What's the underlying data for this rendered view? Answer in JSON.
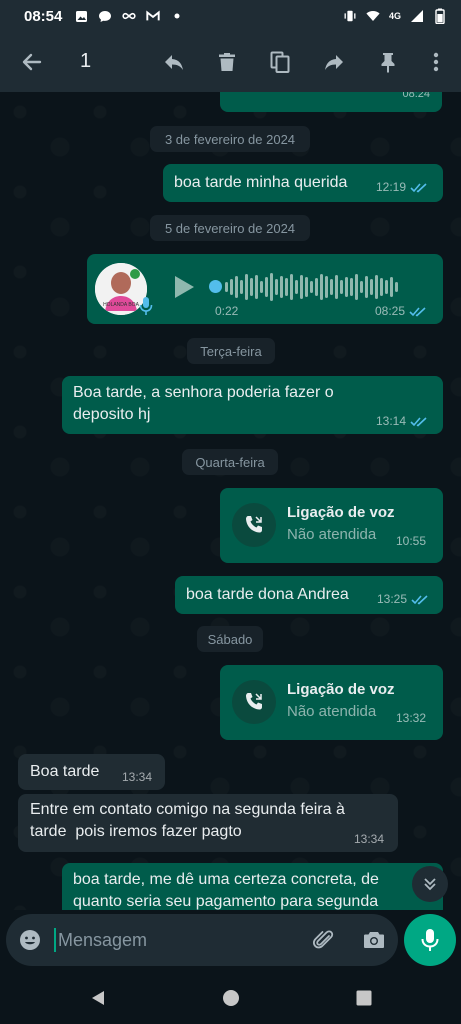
{
  "status_bar": {
    "time": "08:54",
    "network": "4G",
    "left_icons": [
      "image-icon",
      "chat-bubble-icon",
      "infinity-icon",
      "gmail-icon",
      "dot-icon"
    ],
    "right_icons": [
      "vibrate-icon",
      "wifi-icon",
      "signal-icon",
      "battery-icon"
    ]
  },
  "action_bar": {
    "selected_count": "1",
    "actions": [
      "back",
      "reply",
      "delete",
      "copy",
      "forward",
      "pin",
      "more"
    ]
  },
  "messages": {
    "top_partial_time": "08:24",
    "date1": "3 de fevereiro de 2024",
    "m1_text": "boa tarde minha querida",
    "m1_time": "12:19",
    "date2": "5 de fevereiro de 2024",
    "voice": {
      "duration": "0:22",
      "time": "08:25",
      "avatar_caption": "HOLANDA BOA"
    },
    "date3": "Terça-feira",
    "m2_line1": "Boa tarde, a senhora poderia fazer o",
    "m2_line2": "deposito hj",
    "m2_time": "13:14",
    "date4": "Quarta-feira",
    "call1_title": "Ligação de voz",
    "call1_sub": "Não atendida",
    "call1_time": "10:55",
    "m3_text": "boa tarde dona Andrea",
    "m3_time": "13:25",
    "date5": "Sábado",
    "call2_title": "Ligação de voz",
    "call2_sub": "Não atendida",
    "call2_time": "13:32",
    "in1_text": "Boa tarde",
    "in1_time": "13:34",
    "in2_line1": "Entre em contato comigo na segunda feira à",
    "in2_line2": "tarde  pois iremos fazer pagto",
    "in2_time": "13:34",
    "m4_line1": "boa tarde, me dê uma certeza concreta, de",
    "m4_line2": "quanto seria seu pagamento para segunda"
  },
  "composer": {
    "placeholder": "Mensagem"
  },
  "colors": {
    "outgoing": "#005c4b",
    "incoming": "#202c33",
    "accent": "#00a884",
    "read_ticks": "#53bdeb"
  }
}
